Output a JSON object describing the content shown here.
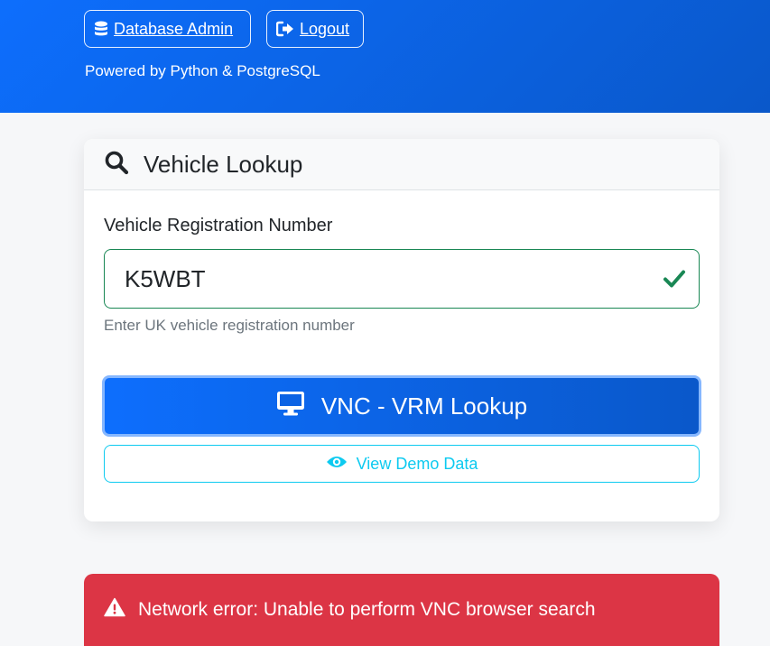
{
  "header": {
    "nav": {
      "database_admin_label": "Database Admin",
      "logout_label": "Logout"
    },
    "powered_by": "Powered by Python & PostgreSQL"
  },
  "lookup_card": {
    "title": "Vehicle Lookup",
    "field_label": "Vehicle Registration Number",
    "registration_value": "K5WBT",
    "help_text": "Enter UK vehicle registration number",
    "primary_button_label": "VNC - VRM Lookup",
    "demo_button_label": "View Demo Data"
  },
  "alert": {
    "message": "Network error: Unable to perform VNC browser search"
  },
  "colors": {
    "primary": "#0d6efd",
    "success": "#198754",
    "info": "#0dcaf0",
    "danger": "#dc3545"
  },
  "icons": {
    "database": "database-icon",
    "logout": "sign-out-icon",
    "search": "search-icon",
    "valid": "check-icon",
    "monitor": "desktop-icon",
    "eye": "eye-icon",
    "warning": "warning-triangle-icon"
  }
}
